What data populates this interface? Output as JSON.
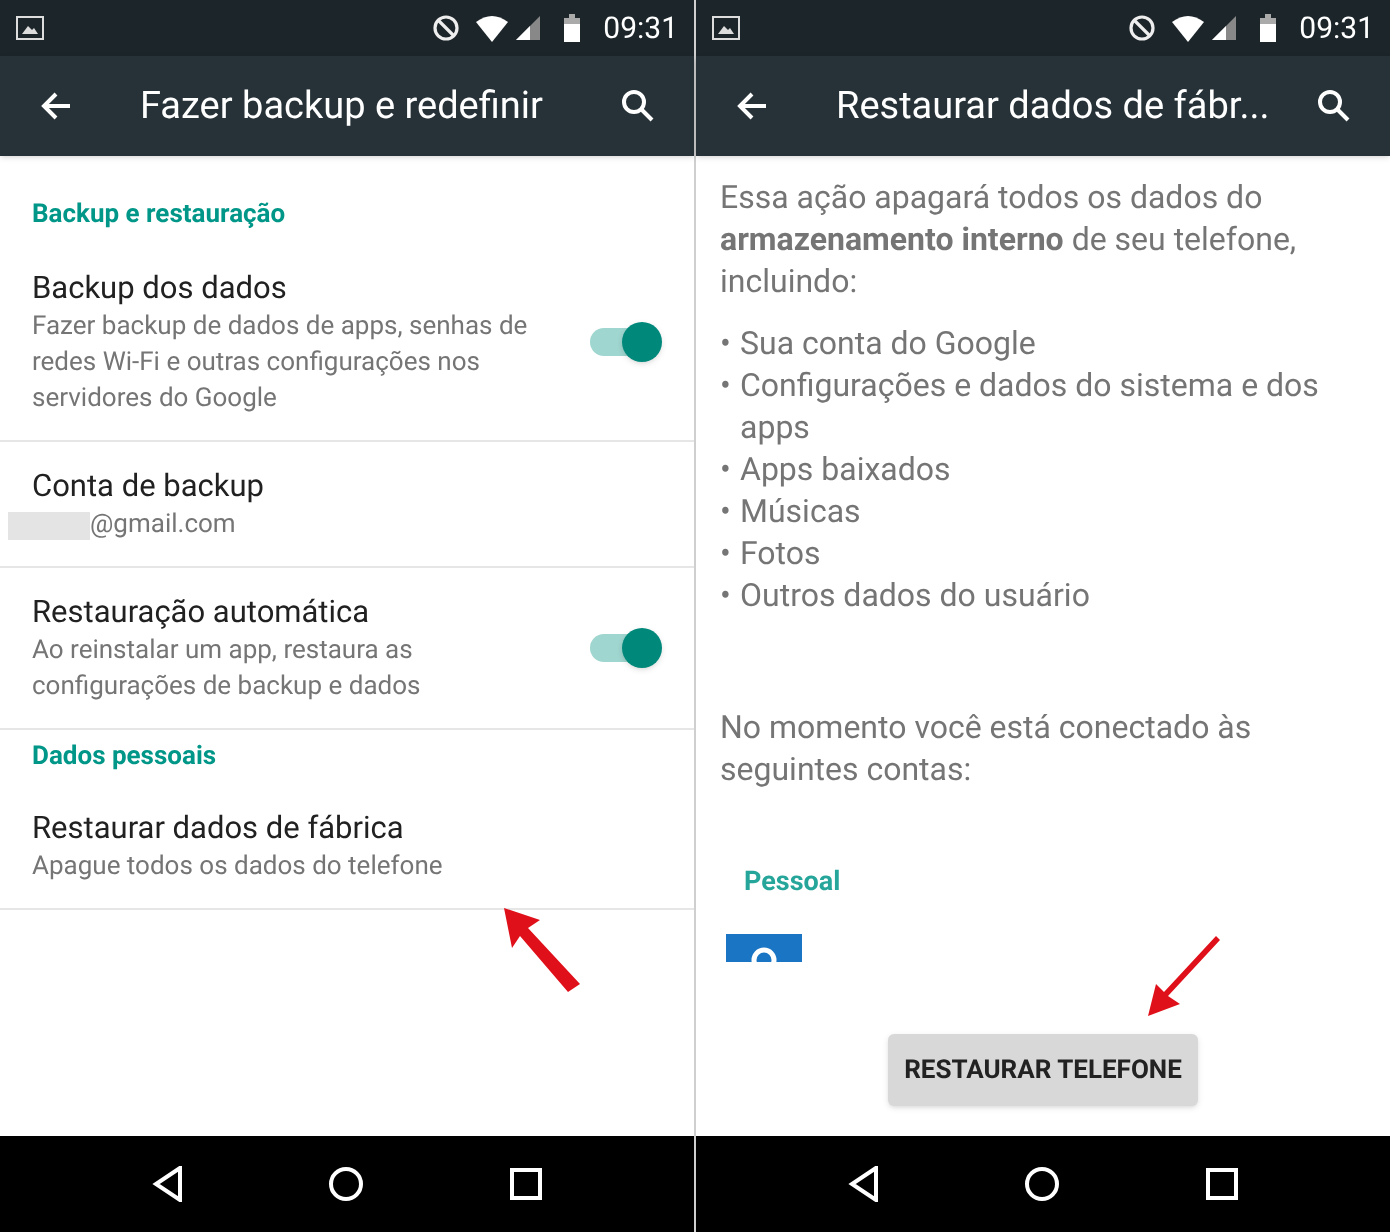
{
  "left_screen": {
    "status_bar": {
      "time": "09:31"
    },
    "app_bar": {
      "title": "Fazer backup e redefinir"
    },
    "sections": [
      {
        "header": "Backup e restauração",
        "items": [
          {
            "kind": "toggle",
            "title": "Backup dos dados",
            "subtitle": "Fazer backup de dados de apps, senhas de redes Wi-Fi e outras configurações nos servidores do Google",
            "on": true
          },
          {
            "kind": "account",
            "title": "Conta de backup",
            "subtitle": "@gmail.com"
          },
          {
            "kind": "toggle",
            "title": "Restauração automática",
            "subtitle": "Ao reinstalar um app, restaura as configurações de backup e dados",
            "on": true
          }
        ]
      },
      {
        "header": "Dados pessoais",
        "items": [
          {
            "kind": "plain",
            "title": "Restaurar dados de fábrica",
            "subtitle": "Apague todos os dados do telefone"
          }
        ]
      }
    ]
  },
  "right_screen": {
    "status_bar": {
      "time": "09:31"
    },
    "app_bar": {
      "title": "Restaurar dados de fábr..."
    },
    "intro": "Essa ação apagará todos os dados do **armazenamento interno** de seu telefone, incluindo:",
    "bullet": "•",
    "list": [
      "Sua conta do Google",
      "Configurações e dados do sistema e dos apps",
      "Apps baixados",
      "Músicas",
      "Fotos",
      "Outros dados do usuário"
    ],
    "accounts_text": "No momento você está conectado às seguintes contas:",
    "account_group": "Pessoal",
    "button": "RESTAURAR TELEFONE"
  }
}
